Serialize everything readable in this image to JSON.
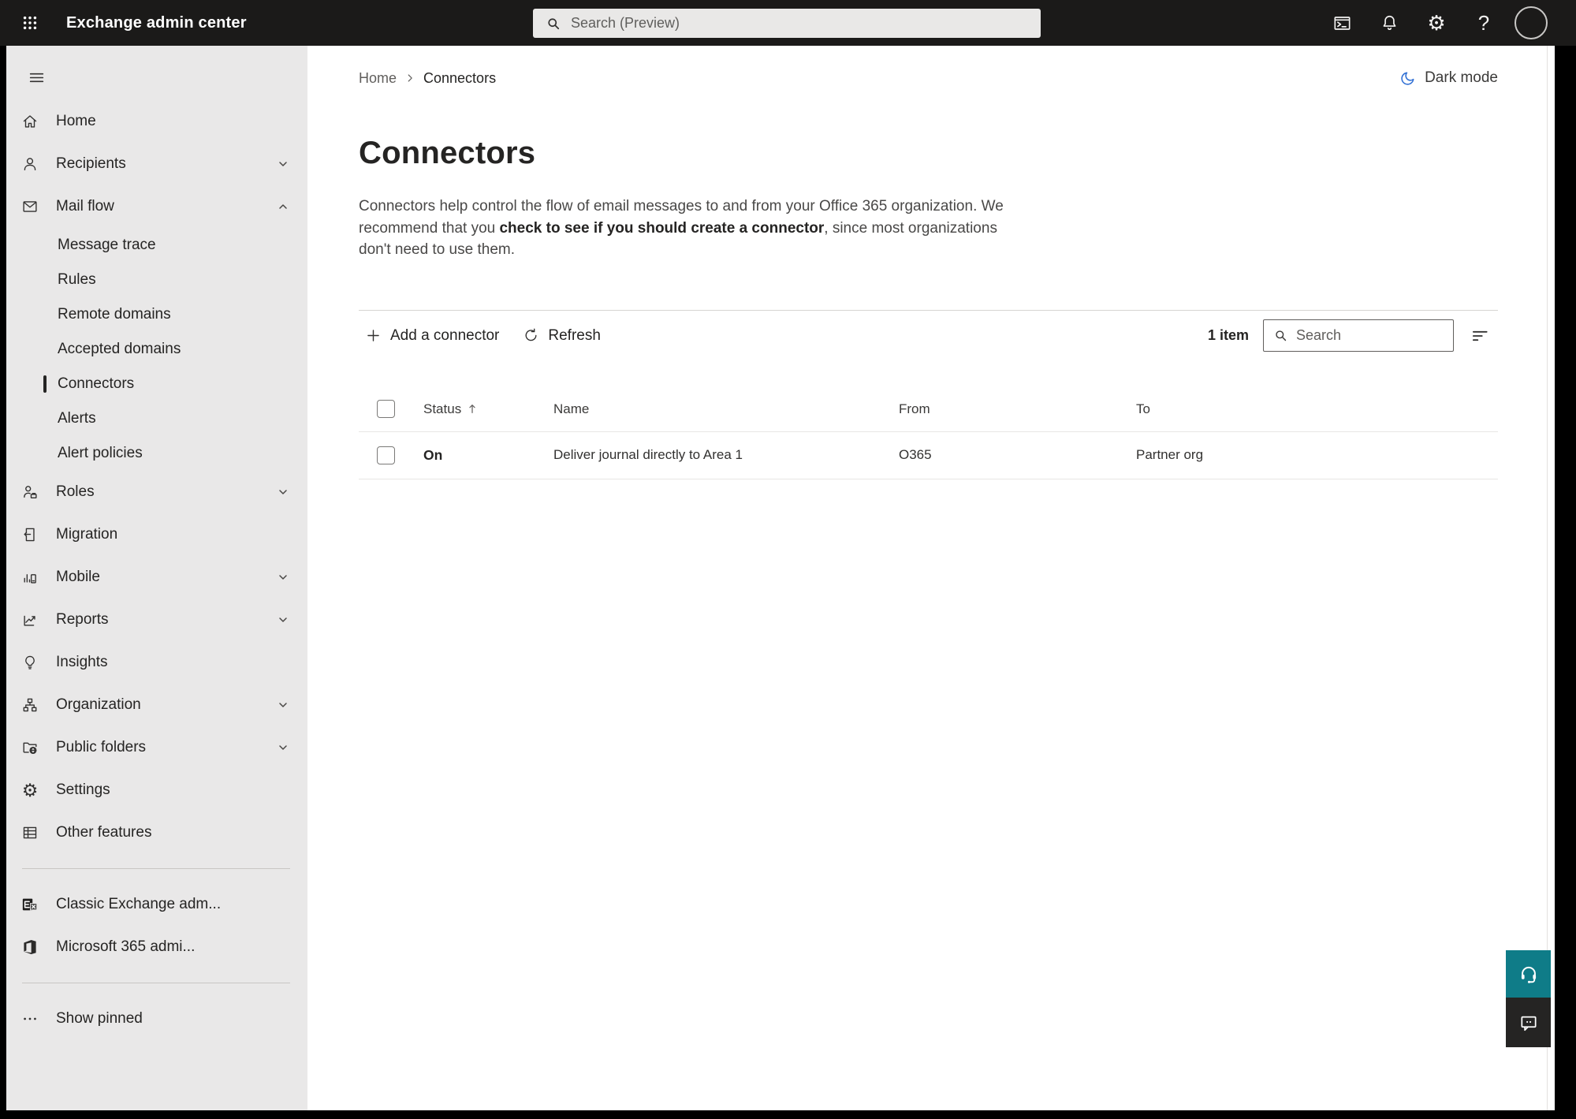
{
  "topbar": {
    "app_title": "Exchange admin center",
    "search_placeholder": "Search (Preview)"
  },
  "glyphs": {
    "gear": "⚙",
    "help": "?"
  },
  "sidebar": {
    "items": [
      {
        "label": "Home",
        "icon": "home-icon"
      },
      {
        "label": "Recipients",
        "icon": "person-icon",
        "chevron": "down"
      },
      {
        "label": "Mail flow",
        "icon": "mail-icon",
        "chevron": "up",
        "expanded": true
      },
      {
        "label": "Message trace",
        "type": "sub"
      },
      {
        "label": "Rules",
        "type": "sub"
      },
      {
        "label": "Remote domains",
        "type": "sub"
      },
      {
        "label": "Accepted domains",
        "type": "sub"
      },
      {
        "label": "Connectors",
        "type": "sub",
        "selected": true
      },
      {
        "label": "Alerts",
        "type": "sub"
      },
      {
        "label": "Alert policies",
        "type": "sub"
      },
      {
        "label": "Roles",
        "icon": "person-badge-icon",
        "chevron": "down"
      },
      {
        "label": "Migration",
        "icon": "migration-icon"
      },
      {
        "label": "Mobile",
        "icon": "mobile-icon",
        "chevron": "down"
      },
      {
        "label": "Reports",
        "icon": "reports-icon",
        "chevron": "down"
      },
      {
        "label": "Insights",
        "icon": "lightbulb-icon"
      },
      {
        "label": "Organization",
        "icon": "org-chart-icon",
        "chevron": "down"
      },
      {
        "label": "Public folders",
        "icon": "folder-globe-icon",
        "chevron": "down"
      },
      {
        "label": "Settings",
        "icon": "gear-icon"
      },
      {
        "label": "Other features",
        "icon": "table-grid-icon"
      },
      {
        "label": "Classic Exchange adm...",
        "icon": "exchange-logo"
      },
      {
        "label": "Microsoft 365 admi...",
        "icon": "m365-logo"
      },
      {
        "label": "Show pinned",
        "icon": "ellipsis-icon"
      }
    ]
  },
  "breadcrumb": {
    "home": "Home",
    "current": "Connectors"
  },
  "header_right": {
    "dark_mode": "Dark mode"
  },
  "page": {
    "title": "Connectors",
    "desc_before": "Connectors help control the flow of email messages to and from your Office 365 organization. We recommend that you ",
    "desc_emphasis": "check to see if you should create a connector",
    "desc_after": ", since most organizations don't need to use them."
  },
  "toolbar": {
    "add": "Add a connector",
    "refresh": "Refresh",
    "count": "1 item",
    "search_placeholder": "Search"
  },
  "table": {
    "headers": {
      "status": "Status",
      "name": "Name",
      "from": "From",
      "to": "To"
    },
    "sort": {
      "column": "Status",
      "direction": "ascending"
    },
    "rows": [
      {
        "status": "On",
        "name": "Deliver journal directly to Area 1",
        "from": "O365",
        "to": "Partner org"
      }
    ]
  },
  "colors": {
    "topbar_bg": "#1b1a19",
    "sidebar_bg": "#e9e8e8",
    "help_teal": "#0f7c88",
    "feedback_dark": "#252423",
    "moon_blue": "#2f6fd4"
  }
}
